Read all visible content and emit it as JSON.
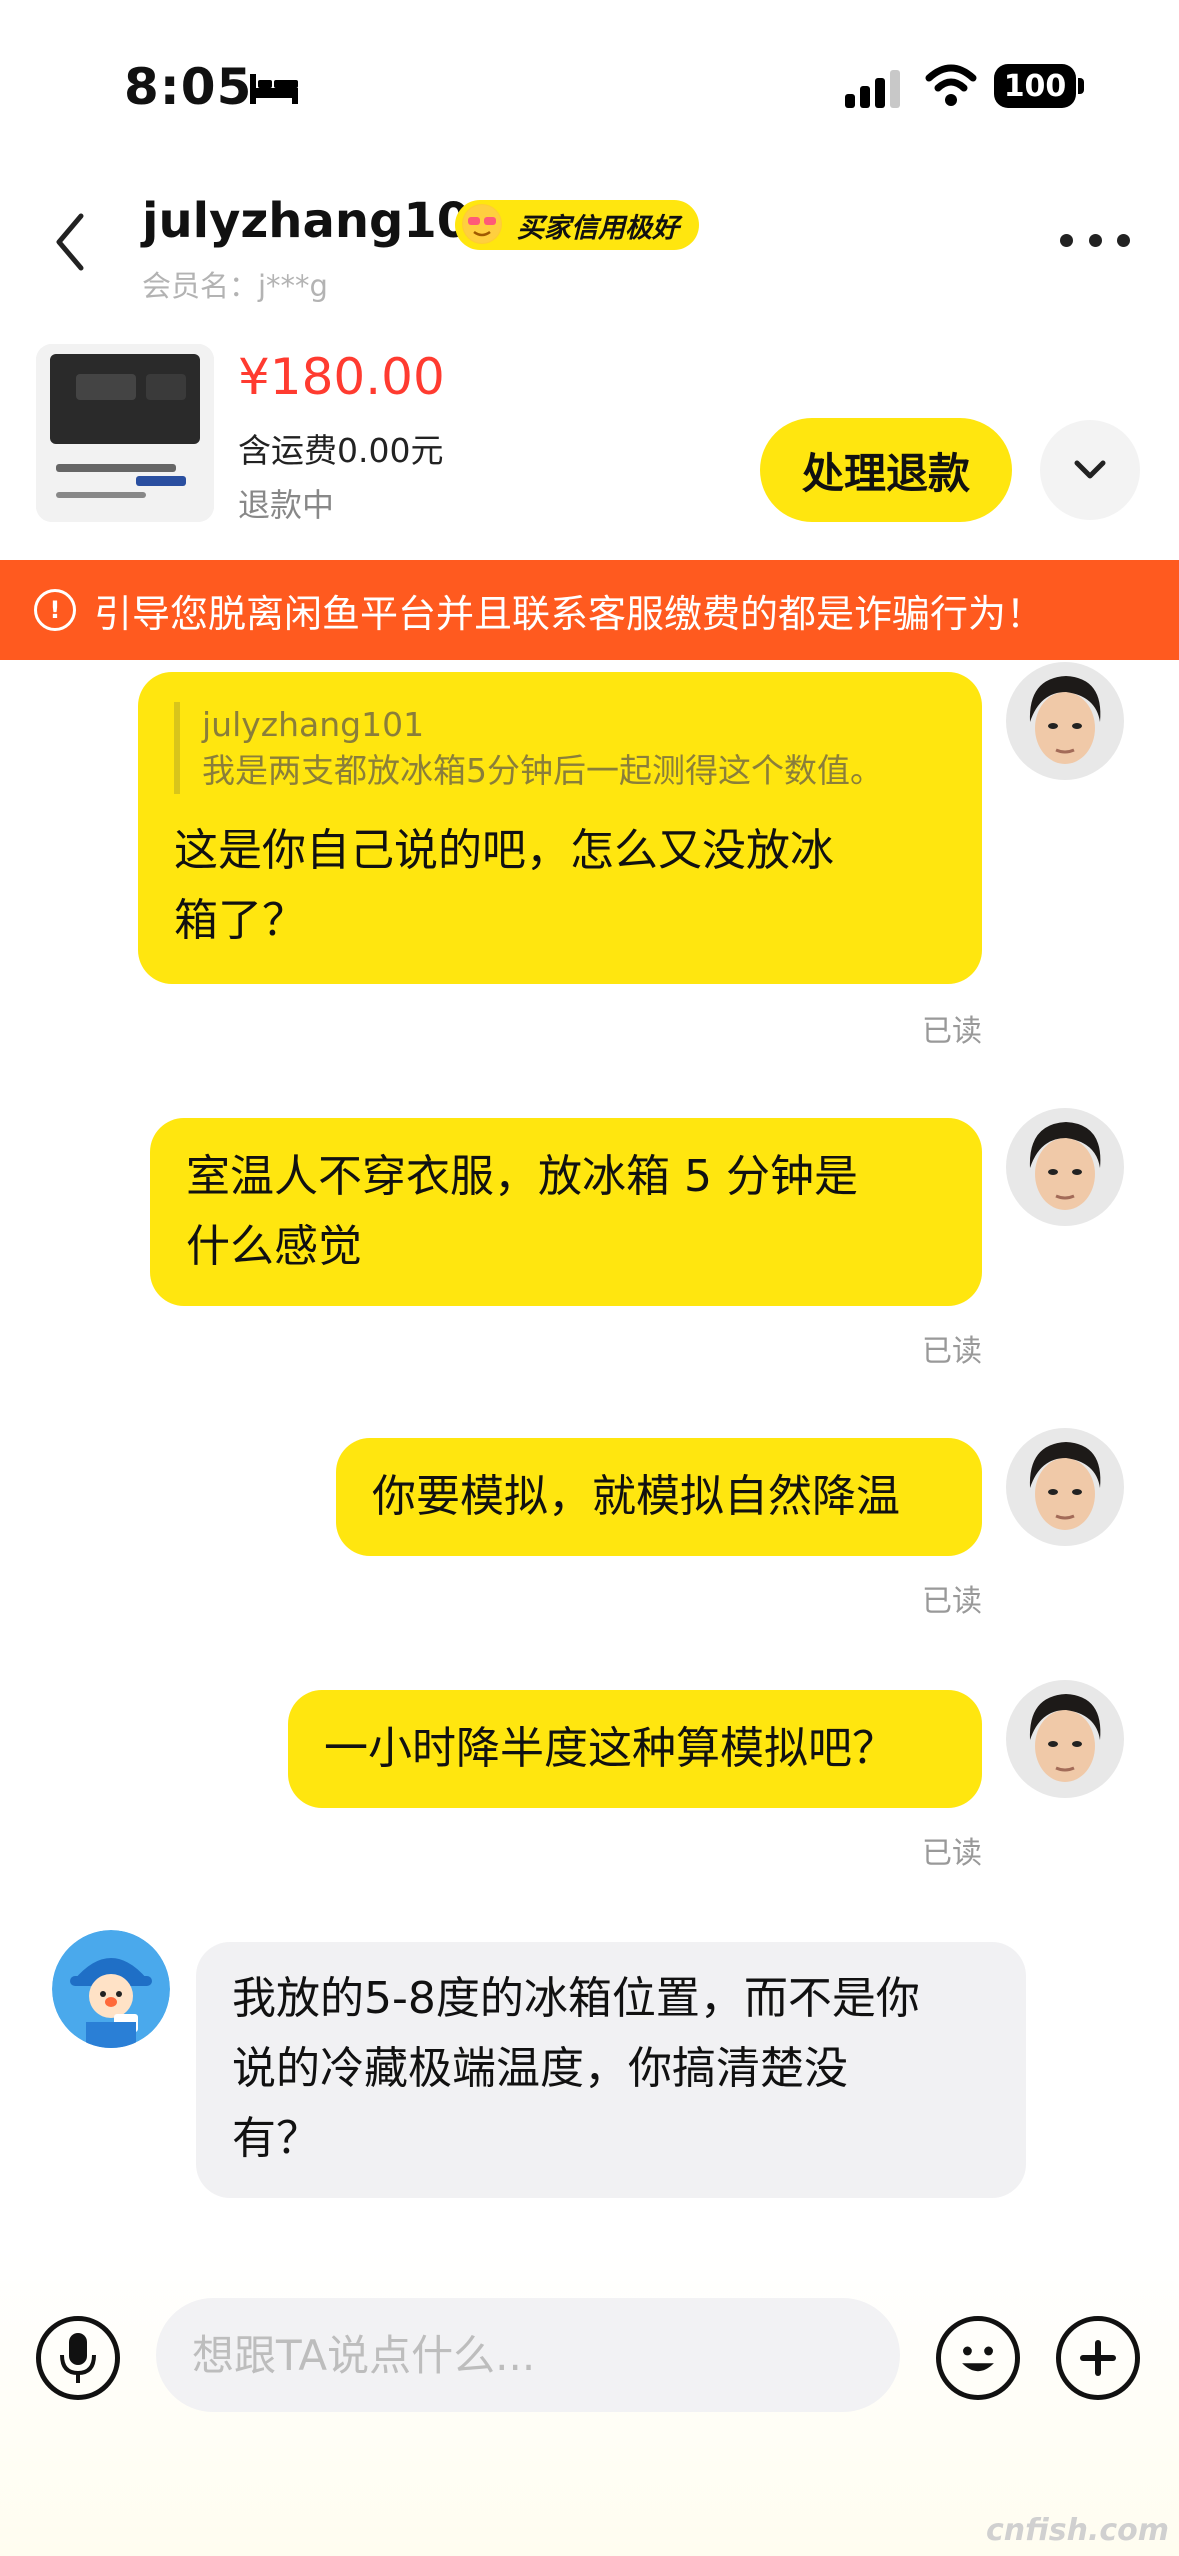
{
  "status_bar": {
    "time": "8:05",
    "battery": "100",
    "icons": [
      "bed-icon",
      "signal-icon",
      "wifi-icon",
      "battery-icon"
    ]
  },
  "header": {
    "username": "julyzhang101",
    "credit_badge": "买家信用极好",
    "member_name": "会员名：j***g"
  },
  "product": {
    "price": "¥180.00",
    "shipping": "含运费0.00元",
    "status": "退款中",
    "action_label": "处理退款"
  },
  "warning": {
    "text": "引导您脱离闲鱼平台并且联系客服缴费的都是诈骗行为！"
  },
  "messages": [
    {
      "direction": "out",
      "quote_author": "julyzhang101",
      "quote_text": "我是两支都放冰箱5分钟后一起测得这个数值。",
      "line1": "这是你自己说的吧，怎么又没放冰",
      "line2": "箱了？",
      "read": "已读"
    },
    {
      "direction": "out",
      "line1": "室温人不穿衣服，放冰箱 5 分钟是",
      "line2": "什么感觉",
      "read": "已读"
    },
    {
      "direction": "out",
      "line1": "你要模拟，就模拟自然降温",
      "read": "已读"
    },
    {
      "direction": "out",
      "line1": "一小时降半度这种算模拟吧？",
      "read": "已读"
    },
    {
      "direction": "in",
      "line1": "我放的5-8度的冰箱位置，而不是你",
      "line2": "说的冷藏极端温度，你搞清楚没",
      "line3": "有？"
    }
  ],
  "input": {
    "placeholder": "想跟TA说点什么..."
  },
  "watermark": "cnfish.com",
  "colors": {
    "accent": "#ffe60f",
    "warning": "#ff5a1f",
    "price": "#ff3b30"
  }
}
